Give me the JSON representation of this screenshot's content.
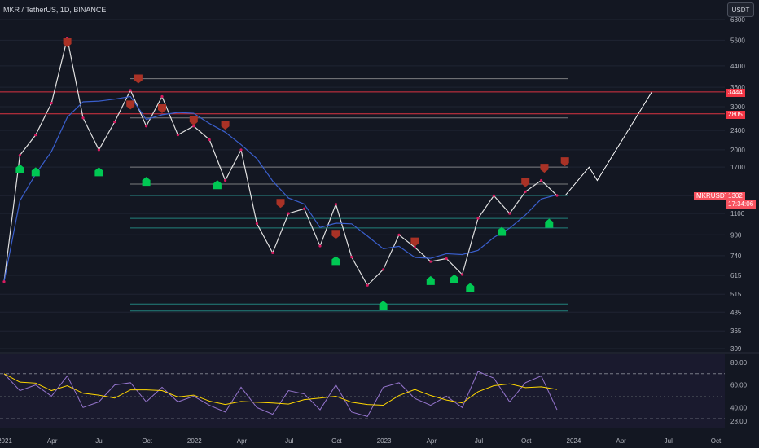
{
  "header": {
    "symbol_line": "MKR / TetherUS, 1D, BINANCE",
    "currency_button": "USDT"
  },
  "price_tags": {
    "level_high": "3444",
    "level_mid": "2805",
    "symbol_badge": "MKRUSDT",
    "last_price": "1302",
    "countdown": "17:34:06"
  },
  "colors": {
    "background": "#131722",
    "sell_marker": "#a93226",
    "buy_marker": "#00c853",
    "moving_average": "#3a5fcd",
    "resistance_line": "#f23645",
    "support_zone": "#26a69a",
    "rsi_line": "#9575cd",
    "rsi_signal": "#ffd700"
  },
  "chart_data": [
    {
      "type": "line",
      "title": "MKR / TetherUS, 1D, BINANCE",
      "scale": "log",
      "y_ticks": [
        309,
        365,
        435,
        515,
        615,
        740,
        900,
        1100,
        1300,
        1700,
        2000,
        2400,
        3000,
        3600,
        4400,
        5600,
        6800
      ],
      "x_ticks": [
        "2021",
        "Apr",
        "Jul",
        "Oct",
        "2022",
        "Apr",
        "Jul",
        "Oct",
        "2023",
        "Apr",
        "Jul",
        "Oct",
        "2024",
        "Apr",
        "Jul",
        "Oct"
      ],
      "series": [
        {
          "x": [
            "2021-01",
            "2021-02",
            "2021-03",
            "2021-04",
            "2021-05",
            "2021-06",
            "2021-07",
            "2021-08",
            "2021-09",
            "2021-10",
            "2021-11",
            "2021-12",
            "2022-01",
            "2022-02",
            "2022-03",
            "2022-04",
            "2022-05",
            "2022-06",
            "2022-07",
            "2022-08",
            "2022-09",
            "2022-10",
            "2022-11",
            "2022-12",
            "2023-01",
            "2023-02",
            "2023-03",
            "2023-04",
            "2023-05",
            "2023-06",
            "2023-07",
            "2023-08",
            "2023-09",
            "2023-10",
            "2023-11",
            "2023-12"
          ],
          "y": [
            580,
            1900,
            2300,
            3100,
            5700,
            2700,
            2000,
            2600,
            3500,
            2500,
            3300,
            2300,
            2500,
            2200,
            1500,
            2000,
            1000,
            760,
            1100,
            1150,
            810,
            1200,
            730,
            560,
            650,
            900,
            800,
            700,
            720,
            620,
            1050,
            1300,
            1100,
            1350,
            1500,
            1302
          ]
        }
      ],
      "horizontal_levels": [
        3444,
        2805,
        2700,
        3900,
        1700,
        1450,
        1302,
        1050,
        960,
        470,
        440
      ],
      "sell_signals": [
        5200,
        2900,
        3700,
        2800,
        2500,
        2400,
        1150,
        860,
        800,
        1400,
        1600,
        1700
      ],
      "buy_signals": [
        1800,
        1750,
        1750,
        1600,
        1550,
        760,
        500,
        630,
        640,
        590,
        1000,
        1080
      ],
      "projection": [
        1302,
        1700,
        1500,
        3444
      ]
    },
    {
      "type": "line",
      "title": "",
      "y_ticks": [
        28.0,
        40.0,
        60.0,
        80.0
      ],
      "ylim": [
        20,
        85
      ],
      "band": [
        30,
        70
      ],
      "series": [
        {
          "x": [
            "2021-01",
            "2021-02",
            "2021-03",
            "2021-04",
            "2021-05",
            "2021-06",
            "2021-07",
            "2021-08",
            "2021-09",
            "2021-10",
            "2021-11",
            "2021-12",
            "2022-01",
            "2022-02",
            "2022-03",
            "2022-04",
            "2022-05",
            "2022-06",
            "2022-07",
            "2022-08",
            "2022-09",
            "2022-10",
            "2022-11",
            "2022-12",
            "2023-01",
            "2023-02",
            "2023-03",
            "2023-04",
            "2023-05",
            "2023-06",
            "2023-07",
            "2023-08",
            "2023-09",
            "2023-10",
            "2023-11",
            "2023-12"
          ],
          "y": [
            70,
            55,
            60,
            50,
            68,
            40,
            45,
            60,
            62,
            45,
            58,
            45,
            50,
            42,
            36,
            58,
            40,
            34,
            55,
            52,
            38,
            60,
            36,
            32,
            58,
            62,
            48,
            42,
            50,
            40,
            72,
            66,
            45,
            62,
            68,
            38
          ]
        }
      ]
    }
  ]
}
